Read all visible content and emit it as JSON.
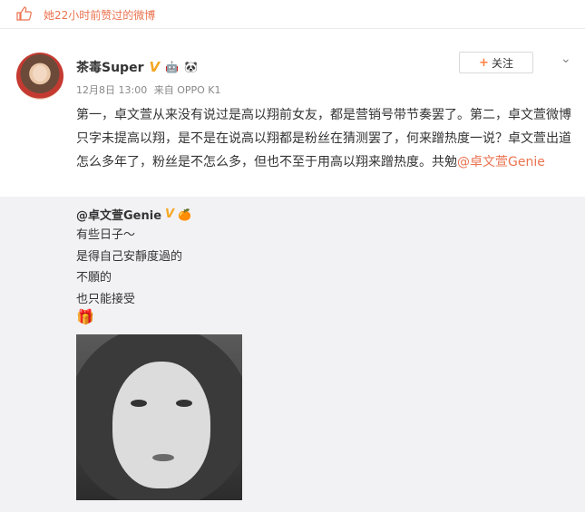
{
  "liked_notice": "她22小时前赞过的微博",
  "post": {
    "username": "茶毒Super",
    "v_badge": "V",
    "badge_emoji_1": "🤖",
    "badge_emoji_2": "🐼",
    "date": "12月8日 13:00",
    "source": "来自 OPPO K1",
    "follow_label": "关注",
    "text_before": "第一，卓文萱从来没有说过是高以翔前女友，都是营销号带节奏罢了。第二，卓文萱微博只字未提高以翔，是不是在说高以翔都是粉丝在猜测罢了，何来蹭热度一说？卓文萱出道怎么多年了，粉丝是不怎么多，但也不至于用高以翔来蹭热度。共勉",
    "mention": "@卓文萱Genie"
  },
  "repost": {
    "author": "@卓文萱Genie",
    "v_badge": "V",
    "badge_emoji": "🍊",
    "lines": [
      "有些日子～",
      "是得自己安靜度過的",
      "不願的",
      "也只能接受"
    ],
    "emoji": "🎁"
  },
  "colors": {
    "accent": "#eb7350",
    "verified": "#f5a623",
    "repost_bg": "#f2f2f5"
  }
}
